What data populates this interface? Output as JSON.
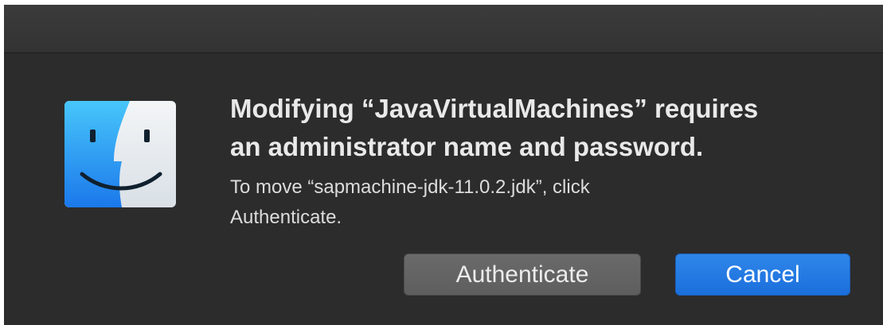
{
  "dialog": {
    "heading_line1": "Modifying “JavaVirtualMachines” requires",
    "heading_line2": "an administrator name and password.",
    "message_line1": "To move “sapmachine-jdk-11.0.2.jdk”, click",
    "message_line2": "Authenticate.",
    "app_icon": "finder-icon"
  },
  "buttons": {
    "authenticate_label": "Authenticate",
    "cancel_label": "Cancel"
  },
  "colors": {
    "background": "#2c2c2c",
    "primary_button": "#1b6fdc",
    "secondary_button": "#5e5e5e"
  }
}
